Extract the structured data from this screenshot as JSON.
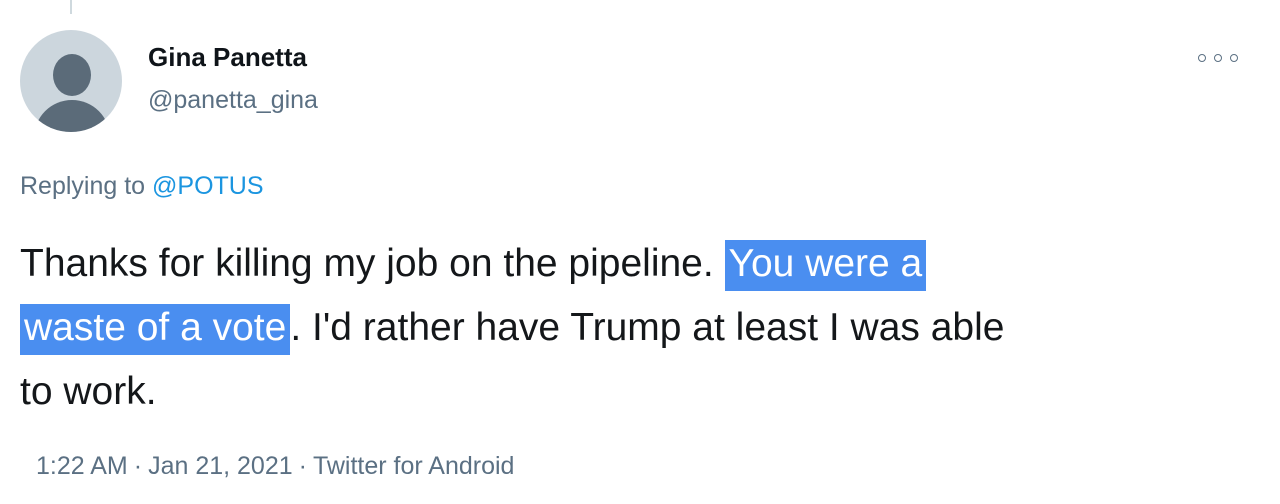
{
  "author": {
    "display_name": "Gina Panetta",
    "handle": "@panetta_gina"
  },
  "reply": {
    "prefix": "Replying to ",
    "mention": "@POTUS"
  },
  "tweet": {
    "text_before": "Thanks for killing my job on the pipeline. ",
    "text_highlight_1": "You were a",
    "text_highlight_2": "waste of a vote",
    "text_after": ". I'd rather have Trump at least I was able",
    "text_last": "to work."
  },
  "meta": {
    "time": "1:22 AM",
    "separator": "·",
    "date": "Jan 21, 2021",
    "source": "Twitter for Android"
  },
  "icons": {
    "more": "more-options-icon",
    "avatar": "default-profile-icon"
  },
  "colors": {
    "highlight": "#4a8ef0",
    "mention": "#1b95e0",
    "secondary_text": "#5b7083"
  }
}
